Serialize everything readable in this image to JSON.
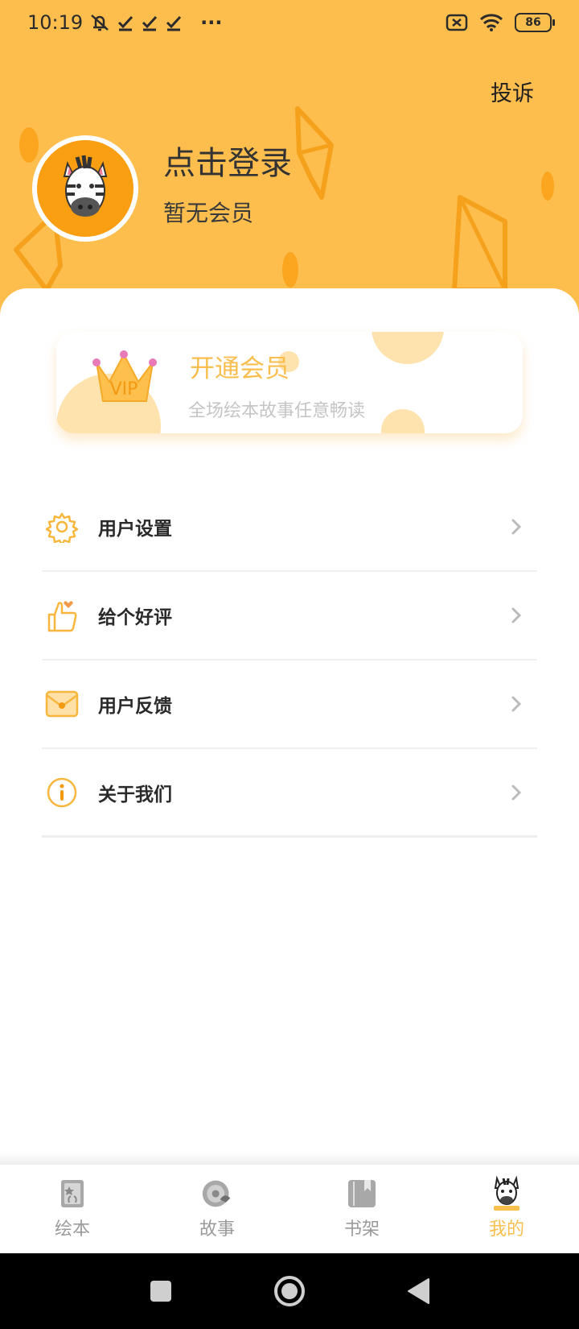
{
  "status_bar": {
    "time": "10:19",
    "battery": "86",
    "more": "···"
  },
  "header": {
    "complaint": "投诉",
    "login": "点击登录",
    "membership": "暂无会员"
  },
  "vip_card": {
    "badge": "VIP",
    "title": "开通会员",
    "subtitle": "全场绘本故事任意畅读"
  },
  "menu": [
    {
      "label": "用户设置",
      "icon": "gear-icon"
    },
    {
      "label": "给个好评",
      "icon": "thumbs-up-icon"
    },
    {
      "label": "用户反馈",
      "icon": "envelope-icon"
    },
    {
      "label": "关于我们",
      "icon": "info-icon"
    }
  ],
  "tabs": [
    {
      "label": "绘本",
      "icon": "picture-book-icon"
    },
    {
      "label": "故事",
      "icon": "story-disc-icon"
    },
    {
      "label": "书架",
      "icon": "bookshelf-icon"
    },
    {
      "label": "我的",
      "icon": "zebra-profile-icon",
      "active": true
    }
  ],
  "colors": {
    "accent": "#FDBE4E",
    "avatar_bg": "#FA9E12",
    "vip_text": "#F9BE4E",
    "tab_active": "#F9C04F",
    "tab_inactive": "#9a9a9a"
  }
}
